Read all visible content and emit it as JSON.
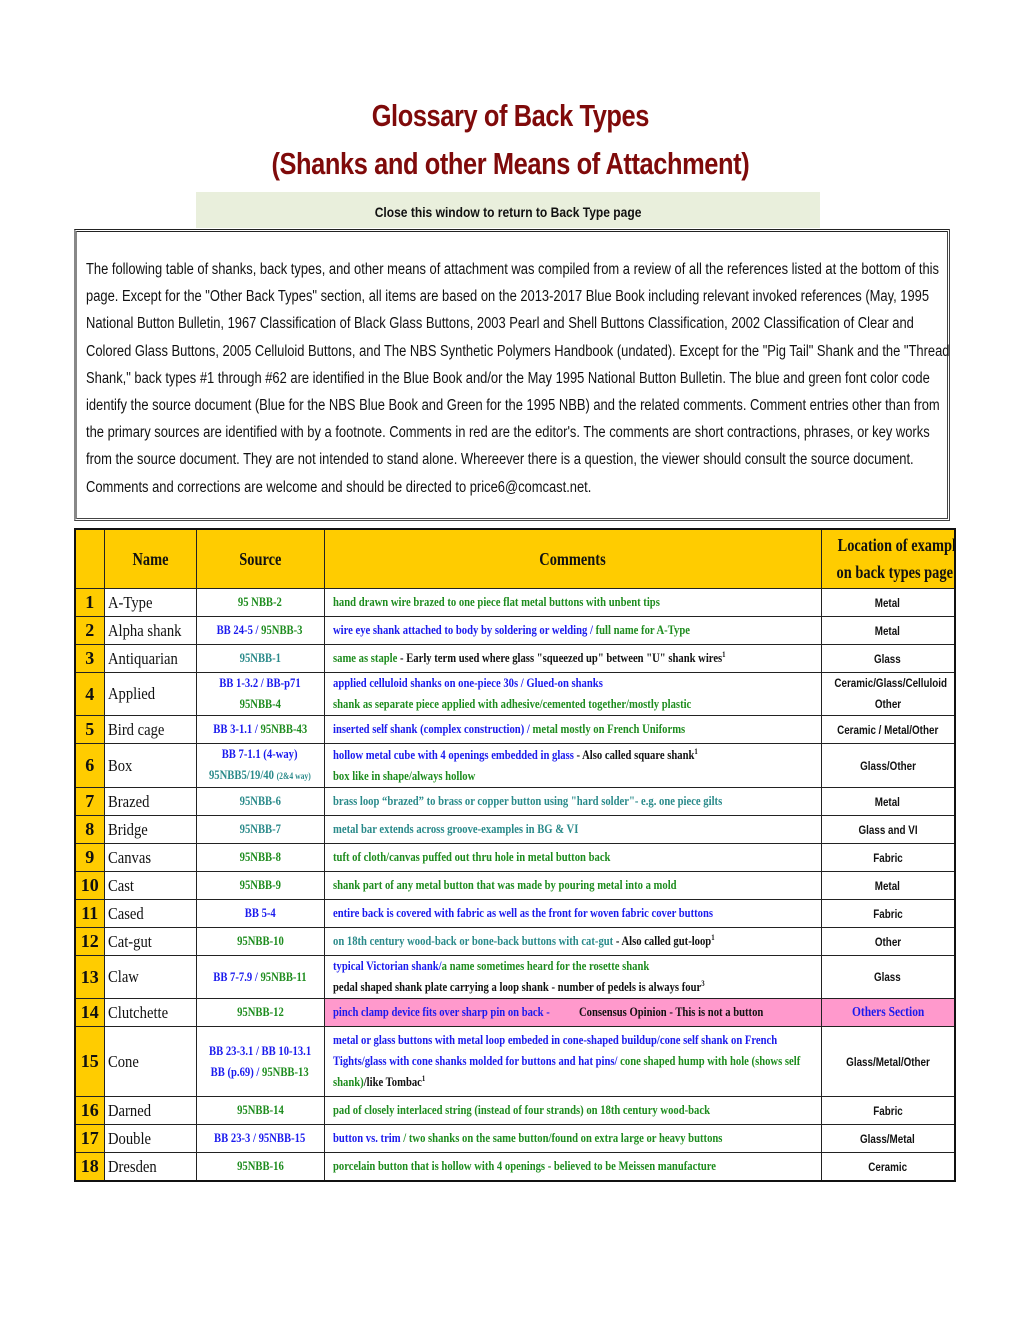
{
  "colors": {
    "title": "#7f0a0a",
    "blue_book": "#1a1aee",
    "nbb_green": "#1e8c1e",
    "teal": "#2a8a8a",
    "editor_black": "#111111",
    "header_gold": "#ffcc00",
    "highlight_pink": "#ff99cc",
    "close_bar_bg": "#e9efdc"
  },
  "header": {
    "title_line1": "Glossary of Back Types",
    "title_line2": "(Shanks and other Means of Attachment)",
    "close_link": "Close this window to return to Back Type page"
  },
  "intro": {
    "text": "The following table of shanks, back types, and other means of attachment was compiled from a review of all the references listed at the bottom of this page. Except for the \"Other Back Types\" section, all items are based on the 2013-2017 Blue Book including relevant invoked references (May, 1995 National Button Bulletin, 1967 Classification of Black Glass Buttons,  2003 Pearl and Shell Buttons Classification, 2002 Classification of Clear and Colored Glass Buttons, 2005 Celluloid Buttons, and The NBS Synthetic Polymers Handbook (undated).  Except for the \"Pig Tail\" Shank and the \"Thread Shank,\" back types #1 through #62 are identified in the Blue Book and/or the May 1995 National Button Bulletin. The blue and green font color code identify the source document (Blue for the NBS Blue Book and Green for the 1995 NBB) and the related comments. Comment entries other than from the primary sources are identified with by a footnote. Comments in red are the editor's. The comments are short contractions, phrases, or key works from the source document. They are not intended to stand alone. Whereever there is a question, the viewer should consult the source document. Comments and corrections are welcome and should be directed to price6@comcast.net."
  },
  "table": {
    "columns": [
      "",
      "Name",
      "Source",
      "Comments",
      "Location of example on back types page"
    ],
    "col_location_line1": "Location of example",
    "col_location_line2": "on back types page",
    "rows": [
      {
        "num": "1",
        "name": "A-Type",
        "height": "r1",
        "source": [
          [
            {
              "t": "95 NBB-2",
              "c": "g"
            }
          ]
        ],
        "comments": [
          [
            {
              "t": "hand drawn wire brazed to one piece flat metal buttons with unbent tips",
              "c": "g"
            }
          ]
        ],
        "location": [
          "Metal"
        ]
      },
      {
        "num": "2",
        "name": "Alpha shank",
        "height": "r1",
        "source": [
          [
            {
              "t": "BB 24-5 / ",
              "c": "b"
            },
            {
              "t": "95NBB-3",
              "c": "g"
            }
          ]
        ],
        "comments": [
          [
            {
              "t": "wire eye shank attached to body by soldering or welding / ",
              "c": "b"
            },
            {
              "t": "full name for A-Type",
              "c": "g"
            }
          ]
        ],
        "location": [
          "Metal"
        ]
      },
      {
        "num": "3",
        "name": "Antiquarian",
        "height": "r1",
        "source": [
          [
            {
              "t": "95NBB-1",
              "c": "t"
            }
          ]
        ],
        "comments": [
          [
            {
              "t": "same as staple",
              "c": "g"
            },
            {
              "t": " - Early term used where glass \"squeezed up\" between \"U\" shank wires",
              "c": "k"
            },
            {
              "t": "1",
              "c": "k",
              "sup": true
            }
          ]
        ],
        "location": [
          "Glass"
        ]
      },
      {
        "num": "4",
        "name": "Applied",
        "height": "r2",
        "source": [
          [
            {
              "t": "BB 1-3.2 / BB-p71",
              "c": "b"
            }
          ],
          [
            {
              "t": "95NBB-4",
              "c": "g"
            }
          ]
        ],
        "comments": [
          [
            {
              "t": "applied celluloid shanks on one-piece 30s / Glued-on shanks",
              "c": "b"
            }
          ],
          [
            {
              "t": "shank as separate piece applied with adhesive/cemented together/mostly plastic",
              "c": "g"
            }
          ]
        ],
        "location": [
          "Ceramic/Glass/Celluloid",
          "Other"
        ]
      },
      {
        "num": "5",
        "name": "Bird cage",
        "height": "r1",
        "source": [
          [
            {
              "t": "BB 3-1.1 / ",
              "c": "b"
            },
            {
              "t": "95NBB-43",
              "c": "g"
            }
          ]
        ],
        "comments": [
          [
            {
              "t": "inserted self shank (complex construction) / ",
              "c": "b"
            },
            {
              "t": "metal mostly on French Uniforms",
              "c": "g"
            }
          ]
        ],
        "location": [
          "Ceramic / Metal/Other"
        ]
      },
      {
        "num": "6",
        "name": "Box",
        "height": "r2",
        "source": [
          [
            {
              "t": "BB 7-1.1 (4-way)",
              "c": "b"
            }
          ],
          [
            {
              "t": "95NBB5/19/40 ",
              "c": "t"
            },
            {
              "t": "(2&4 way)",
              "c": "t",
              "small": true
            }
          ]
        ],
        "comments": [
          [
            {
              "t": "hollow metal cube with 4 openings embedded in glass",
              "c": "b"
            },
            {
              "t": " - Also called square shank",
              "c": "k"
            },
            {
              "t": "1",
              "c": "k",
              "sup": true
            }
          ],
          [
            {
              "t": "box like in shape/always hollow",
              "c": "g"
            }
          ]
        ],
        "location": [
          "Glass/Other"
        ]
      },
      {
        "num": "7",
        "name": "Brazed",
        "height": "r1",
        "source": [
          [
            {
              "t": "95NBB-6",
              "c": "t"
            }
          ]
        ],
        "comments": [
          [
            {
              "t": "brass loop “brazed” to brass or copper button using \"hard solder\"- e.g. one piece gilts",
              "c": "t"
            }
          ]
        ],
        "location": [
          "Metal"
        ]
      },
      {
        "num": "8",
        "name": "Bridge",
        "height": "r1",
        "source": [
          [
            {
              "t": "95NBB-7",
              "c": "t"
            }
          ]
        ],
        "comments": [
          [
            {
              "t": "metal bar extends across groove-examples in BG & VI",
              "c": "t"
            }
          ]
        ],
        "location": [
          "Glass and VI"
        ]
      },
      {
        "num": "9",
        "name": "Canvas",
        "height": "r1",
        "source": [
          [
            {
              "t": "95NBB-8",
              "c": "g"
            }
          ]
        ],
        "comments": [
          [
            {
              "t": "tuft of cloth/canvas puffed out thru hole in metal button back",
              "c": "g"
            }
          ]
        ],
        "location": [
          "Fabric"
        ]
      },
      {
        "num": "10",
        "name": "Cast",
        "height": "r1",
        "source": [
          [
            {
              "t": "95NBB-9",
              "c": "g"
            }
          ]
        ],
        "comments": [
          [
            {
              "t": "shank part of any metal button that was made by pouring metal into a mold",
              "c": "g"
            }
          ]
        ],
        "location": [
          "Metal"
        ]
      },
      {
        "num": "11",
        "name": "Cased",
        "height": "r1",
        "source": [
          [
            {
              "t": "BB 5-4",
              "c": "b"
            }
          ]
        ],
        "comments": [
          [
            {
              "t": "entire back is covered with fabric as well as the front for woven fabric cover buttons",
              "c": "b"
            }
          ]
        ],
        "location": [
          "Fabric"
        ]
      },
      {
        "num": "12",
        "name": "Cat-gut",
        "height": "r1",
        "source": [
          [
            {
              "t": "95NBB-10",
              "c": "g"
            }
          ]
        ],
        "comments": [
          [
            {
              "t": "on 18th century wood-back or bone-back buttons with cat-gut",
              "c": "t"
            },
            {
              "t": " - Also called gut-loop",
              "c": "k"
            },
            {
              "t": "1",
              "c": "k",
              "sup": true
            }
          ]
        ],
        "location": [
          "Other"
        ]
      },
      {
        "num": "13",
        "name": "Claw",
        "height": "r2",
        "source": [
          [
            {
              "t": "BB 7-7.9 / ",
              "c": "b"
            },
            {
              "t": "95NBB-11",
              "c": "g"
            }
          ]
        ],
        "comments": [
          [
            {
              "t": "typical Victorian shank/",
              "c": "b"
            },
            {
              "t": "a name sometimes heard for the rosette shank",
              "c": "g"
            }
          ],
          [
            {
              "t": "pedal shaped shank plate carrying a loop shank - number of pedels is always four",
              "c": "k"
            },
            {
              "t": "3",
              "c": "k",
              "sup": true
            }
          ]
        ],
        "location": [
          "Glass"
        ]
      },
      {
        "num": "14",
        "name": "Clutchette",
        "height": "r1",
        "highlight": true,
        "source": [
          [
            {
              "t": "95NBB-12",
              "c": "g"
            }
          ]
        ],
        "comments": [
          [
            {
              "t": "pinch clamp device fits over sharp pin on back - ",
              "c": "b"
            },
            {
              "t": "          Consensus Opinion - This is not a button",
              "c": "k"
            }
          ]
        ],
        "location": [
          "Others Section"
        ],
        "location_color": "b"
      },
      {
        "num": "15",
        "name": "Cone",
        "height": "r3",
        "source": [
          [
            {
              "t": "BB 23-3.1 / BB 10-13.1",
              "c": "b"
            }
          ],
          [
            {
              "t": "BB (p.69) / ",
              "c": "b"
            },
            {
              "t": "95NBB-13",
              "c": "g"
            }
          ]
        ],
        "comments": [
          [
            {
              "t": "metal or glass buttons with metal loop embeded in cone-shaped buildup/cone self shank on French",
              "c": "b"
            }
          ],
          [
            {
              "t": "Tights/glass with cone shanks molded for buttons and hat pins/ ",
              "c": "b"
            },
            {
              "t": "cone shaped hump with hole (shows self",
              "c": "g"
            }
          ],
          [
            {
              "t": "shank)",
              "c": "g"
            },
            {
              "t": "/like Tombac",
              "c": "k"
            },
            {
              "t": "1",
              "c": "k",
              "sup": true
            }
          ]
        ],
        "location": [
          "Glass/Metal/Other"
        ]
      },
      {
        "num": "16",
        "name": "Darned",
        "height": "r1",
        "source": [
          [
            {
              "t": "95NBB-14",
              "c": "g"
            }
          ]
        ],
        "comments": [
          [
            {
              "t": "pad of closely interlaced string (instead of four strands) on 18th century wood-back",
              "c": "g"
            }
          ]
        ],
        "location": [
          "Fabric"
        ]
      },
      {
        "num": "17",
        "name": "Double",
        "height": "r1",
        "source": [
          [
            {
              "t": "BB 23-3 / ",
              "c": "b"
            },
            {
              "t": "95NBB-15",
              "c": "b"
            }
          ]
        ],
        "comments": [
          [
            {
              "t": "button vs. trim",
              "c": "b"
            },
            {
              "t": " / two shanks on the same button/found on extra large or heavy buttons",
              "c": "g"
            }
          ]
        ],
        "location": [
          "Glass/Metal"
        ]
      },
      {
        "num": "18",
        "name": "Dresden",
        "height": "r1",
        "source": [
          [
            {
              "t": "95NBB-16",
              "c": "g"
            }
          ]
        ],
        "comments": [
          [
            {
              "t": "porcelain button that is hollow with 4 openings - believed to be Meissen manufacture",
              "c": "g"
            }
          ]
        ],
        "location": [
          "Ceramic"
        ]
      }
    ]
  }
}
